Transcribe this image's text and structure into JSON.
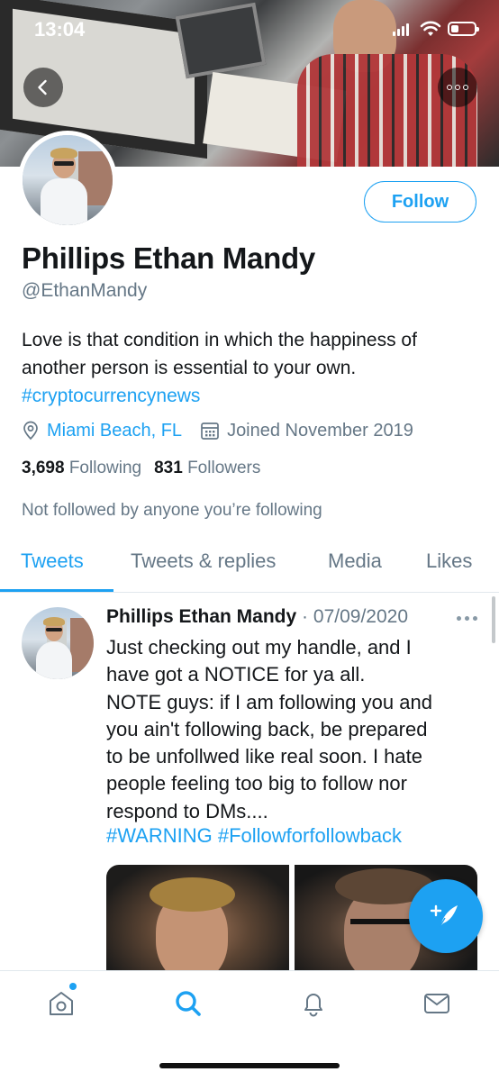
{
  "status_bar": {
    "time": "13:04"
  },
  "profile": {
    "name": "Phillips Ethan Mandy",
    "handle": "@EthanMandy",
    "follow_label": "Follow",
    "bio": "Love is that condition in which the happiness of another person is essential to your own.",
    "bio_hashtag": "#cryptocurrencynews",
    "location": "Miami Beach, FL",
    "joined": "Joined November 2019",
    "following_count": "3,698",
    "following_label": "Following",
    "followers_count": "831",
    "followers_label": "Followers",
    "not_followed": "Not followed by anyone you’re following"
  },
  "tabs": [
    {
      "label": "Tweets",
      "active": true
    },
    {
      "label": "Tweets & replies",
      "active": false
    },
    {
      "label": "Media",
      "active": false
    },
    {
      "label": "Likes",
      "active": false
    }
  ],
  "tweet": {
    "author": "Phillips Ethan Mandy",
    "separator": "·",
    "date": "07/09/2020",
    "text": "Just checking out my handle, and I\nhave got a NOTICE for ya all.\nNOTE guys:  if I am following you and\nyou ain't following back, be prepared\nto be unfollwed like real soon. I hate\npeople feeling too big to follow nor\nrespond to DMs....",
    "hashtags": "#WARNING #Followforfollowback"
  },
  "icons": {
    "back": "back-arrow-icon",
    "more": "more-horizontal-icon",
    "location": "location-pin-icon",
    "calendar": "calendar-icon",
    "compose": "compose-tweet-icon",
    "nav": [
      "home-icon",
      "search-icon",
      "notifications-icon",
      "messages-icon"
    ]
  },
  "colors": {
    "accent": "#1da1f2",
    "secondary_text": "#657786",
    "primary_text": "#14171a"
  }
}
